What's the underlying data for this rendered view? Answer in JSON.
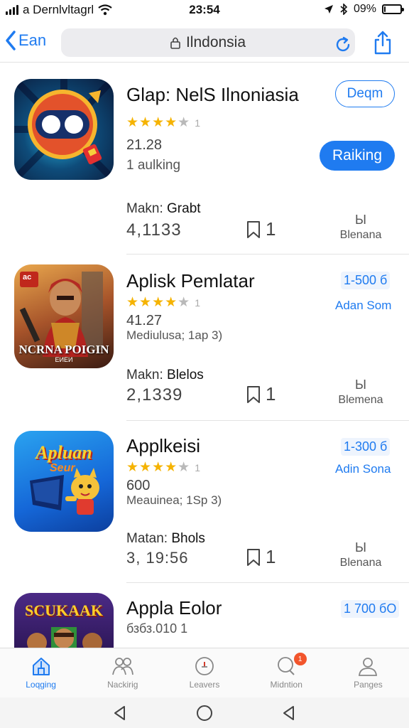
{
  "status": {
    "carrier": "a Dernlvltagrl",
    "time": "23:54",
    "battery": "09%",
    "battery_level": 0.09
  },
  "nav": {
    "back_label": "Ean",
    "url": "Ilndonsia"
  },
  "apps": [
    {
      "name": "Glap: NelS Ilnoniasia",
      "rating": 4,
      "rating_count": "1",
      "line1": "21.28",
      "line2": "1 aulking",
      "make_label": "Makn:",
      "make_value": "Grabt",
      "big_number": "4,1133",
      "bookmark_count": "1",
      "right_icon": "Ы",
      "right_label": "Blenana",
      "action_outline": "Deqm",
      "action_fill": "Raiking"
    },
    {
      "name": "Aplisk Pemlatar",
      "rating": 4,
      "rating_count": "1",
      "line1": "41.27",
      "line2": "Mediulusa; 1ap 3)",
      "make_label": "Makn:",
      "make_value": "Blelos",
      "big_number": "2,1339",
      "bookmark_count": "1",
      "right_icon": "Ы",
      "right_label": "Blemena",
      "price": "1-500 б",
      "sublink": "Adan Som",
      "icon_badge": "ас",
      "icon_title": "NCRNA POIGIN",
      "icon_sub": "ЕИЕИ"
    },
    {
      "name": "Applkeisi",
      "rating": 4,
      "rating_count": "1",
      "line1": "600",
      "line2": "Meauinea; 1Sp 3)",
      "make_label": "Matan:",
      "make_value": "Bhols",
      "big_number": "3, 19:56",
      "bookmark_count": "1",
      "right_icon": "Ы",
      "right_label": "Blenana",
      "price": "1-300 б",
      "sublink": "Adin Sona",
      "icon_title": "Apluan",
      "icon_sub": "Seur"
    },
    {
      "name": "Appla Eolor",
      "line1": "бзбз.010 1",
      "price": "1 700 бО",
      "icon_title": "SCUKAAK"
    }
  ],
  "tabs": [
    {
      "label": "Loqging",
      "icon": "home-icon"
    },
    {
      "label": "Nackirig",
      "icon": "people-icon"
    },
    {
      "label": "Leavers",
      "icon": "compass-icon"
    },
    {
      "label": "Midntion",
      "icon": "chat-icon",
      "badge": "1"
    },
    {
      "label": "Panges",
      "icon": "profile-icon"
    }
  ],
  "colors": {
    "accent": "#1f7bf0",
    "star": "#f5b301",
    "badge": "#f2552c"
  }
}
